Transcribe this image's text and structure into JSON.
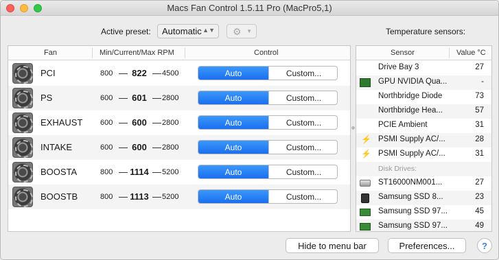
{
  "window": {
    "title": "Macs Fan Control 1.5.11 Pro (MacPro5,1)"
  },
  "preset": {
    "label": "Active preset:",
    "value": "Automatic",
    "chevron_icon": "chevron-updown-icon",
    "gear_icon": "gear-icon"
  },
  "sensors_label": "Temperature sensors:",
  "fan_table": {
    "headers": {
      "fan": "Fan",
      "rpm": "Min/Current/Max RPM",
      "control": "Control"
    },
    "dash": "—",
    "rows": [
      {
        "name": "PCI",
        "min": "800",
        "current": "822",
        "max": "4500",
        "auto": "Auto",
        "custom": "Custom..."
      },
      {
        "name": "PS",
        "min": "600",
        "current": "601",
        "max": "2800",
        "auto": "Auto",
        "custom": "Custom..."
      },
      {
        "name": "EXHAUST",
        "min": "600",
        "current": "600",
        "max": "2800",
        "auto": "Auto",
        "custom": "Custom..."
      },
      {
        "name": "INTAKE",
        "min": "600",
        "current": "600",
        "max": "2800",
        "auto": "Auto",
        "custom": "Custom..."
      },
      {
        "name": "BOOSTA",
        "min": "800",
        "current": "1114",
        "max": "5200",
        "auto": "Auto",
        "custom": "Custom..."
      },
      {
        "name": "BOOSTB",
        "min": "800",
        "current": "1113",
        "max": "5200",
        "auto": "Auto",
        "custom": "Custom..."
      }
    ]
  },
  "sensor_table": {
    "headers": {
      "sensor": "Sensor",
      "value": "Value °C"
    },
    "rows": [
      {
        "name": "Drive Bay 3",
        "value": "27",
        "icon": ""
      },
      {
        "name": "GPU NVIDIA Qua...",
        "value": "-",
        "icon": "gpu-icon"
      },
      {
        "name": "Northbridge Diode",
        "value": "73",
        "icon": ""
      },
      {
        "name": "Northbridge Hea...",
        "value": "57",
        "icon": ""
      },
      {
        "name": "PCIE Ambient",
        "value": "31",
        "icon": ""
      },
      {
        "name": "PSMI Supply AC/...",
        "value": "28",
        "icon": "lightning-bolt-icon"
      },
      {
        "name": "PSMI Supply AC/...",
        "value": "31",
        "icon": "lightning-bolt-icon"
      }
    ],
    "group_label": "Disk Drives:",
    "disk_rows": [
      {
        "name": "ST16000NM001...",
        "value": "27",
        "icon": "hard-drive-icon"
      },
      {
        "name": "Samsung SSD 8...",
        "value": "23",
        "icon": "ssd-icon"
      },
      {
        "name": "Samsung SSD 97...",
        "value": "45",
        "icon": "nvme-ssd-icon"
      },
      {
        "name": "Samsung SSD 97...",
        "value": "49",
        "icon": "nvme-ssd-icon"
      }
    ]
  },
  "footer": {
    "hide": "Hide to menu bar",
    "preferences": "Preferences...",
    "help": "?"
  }
}
